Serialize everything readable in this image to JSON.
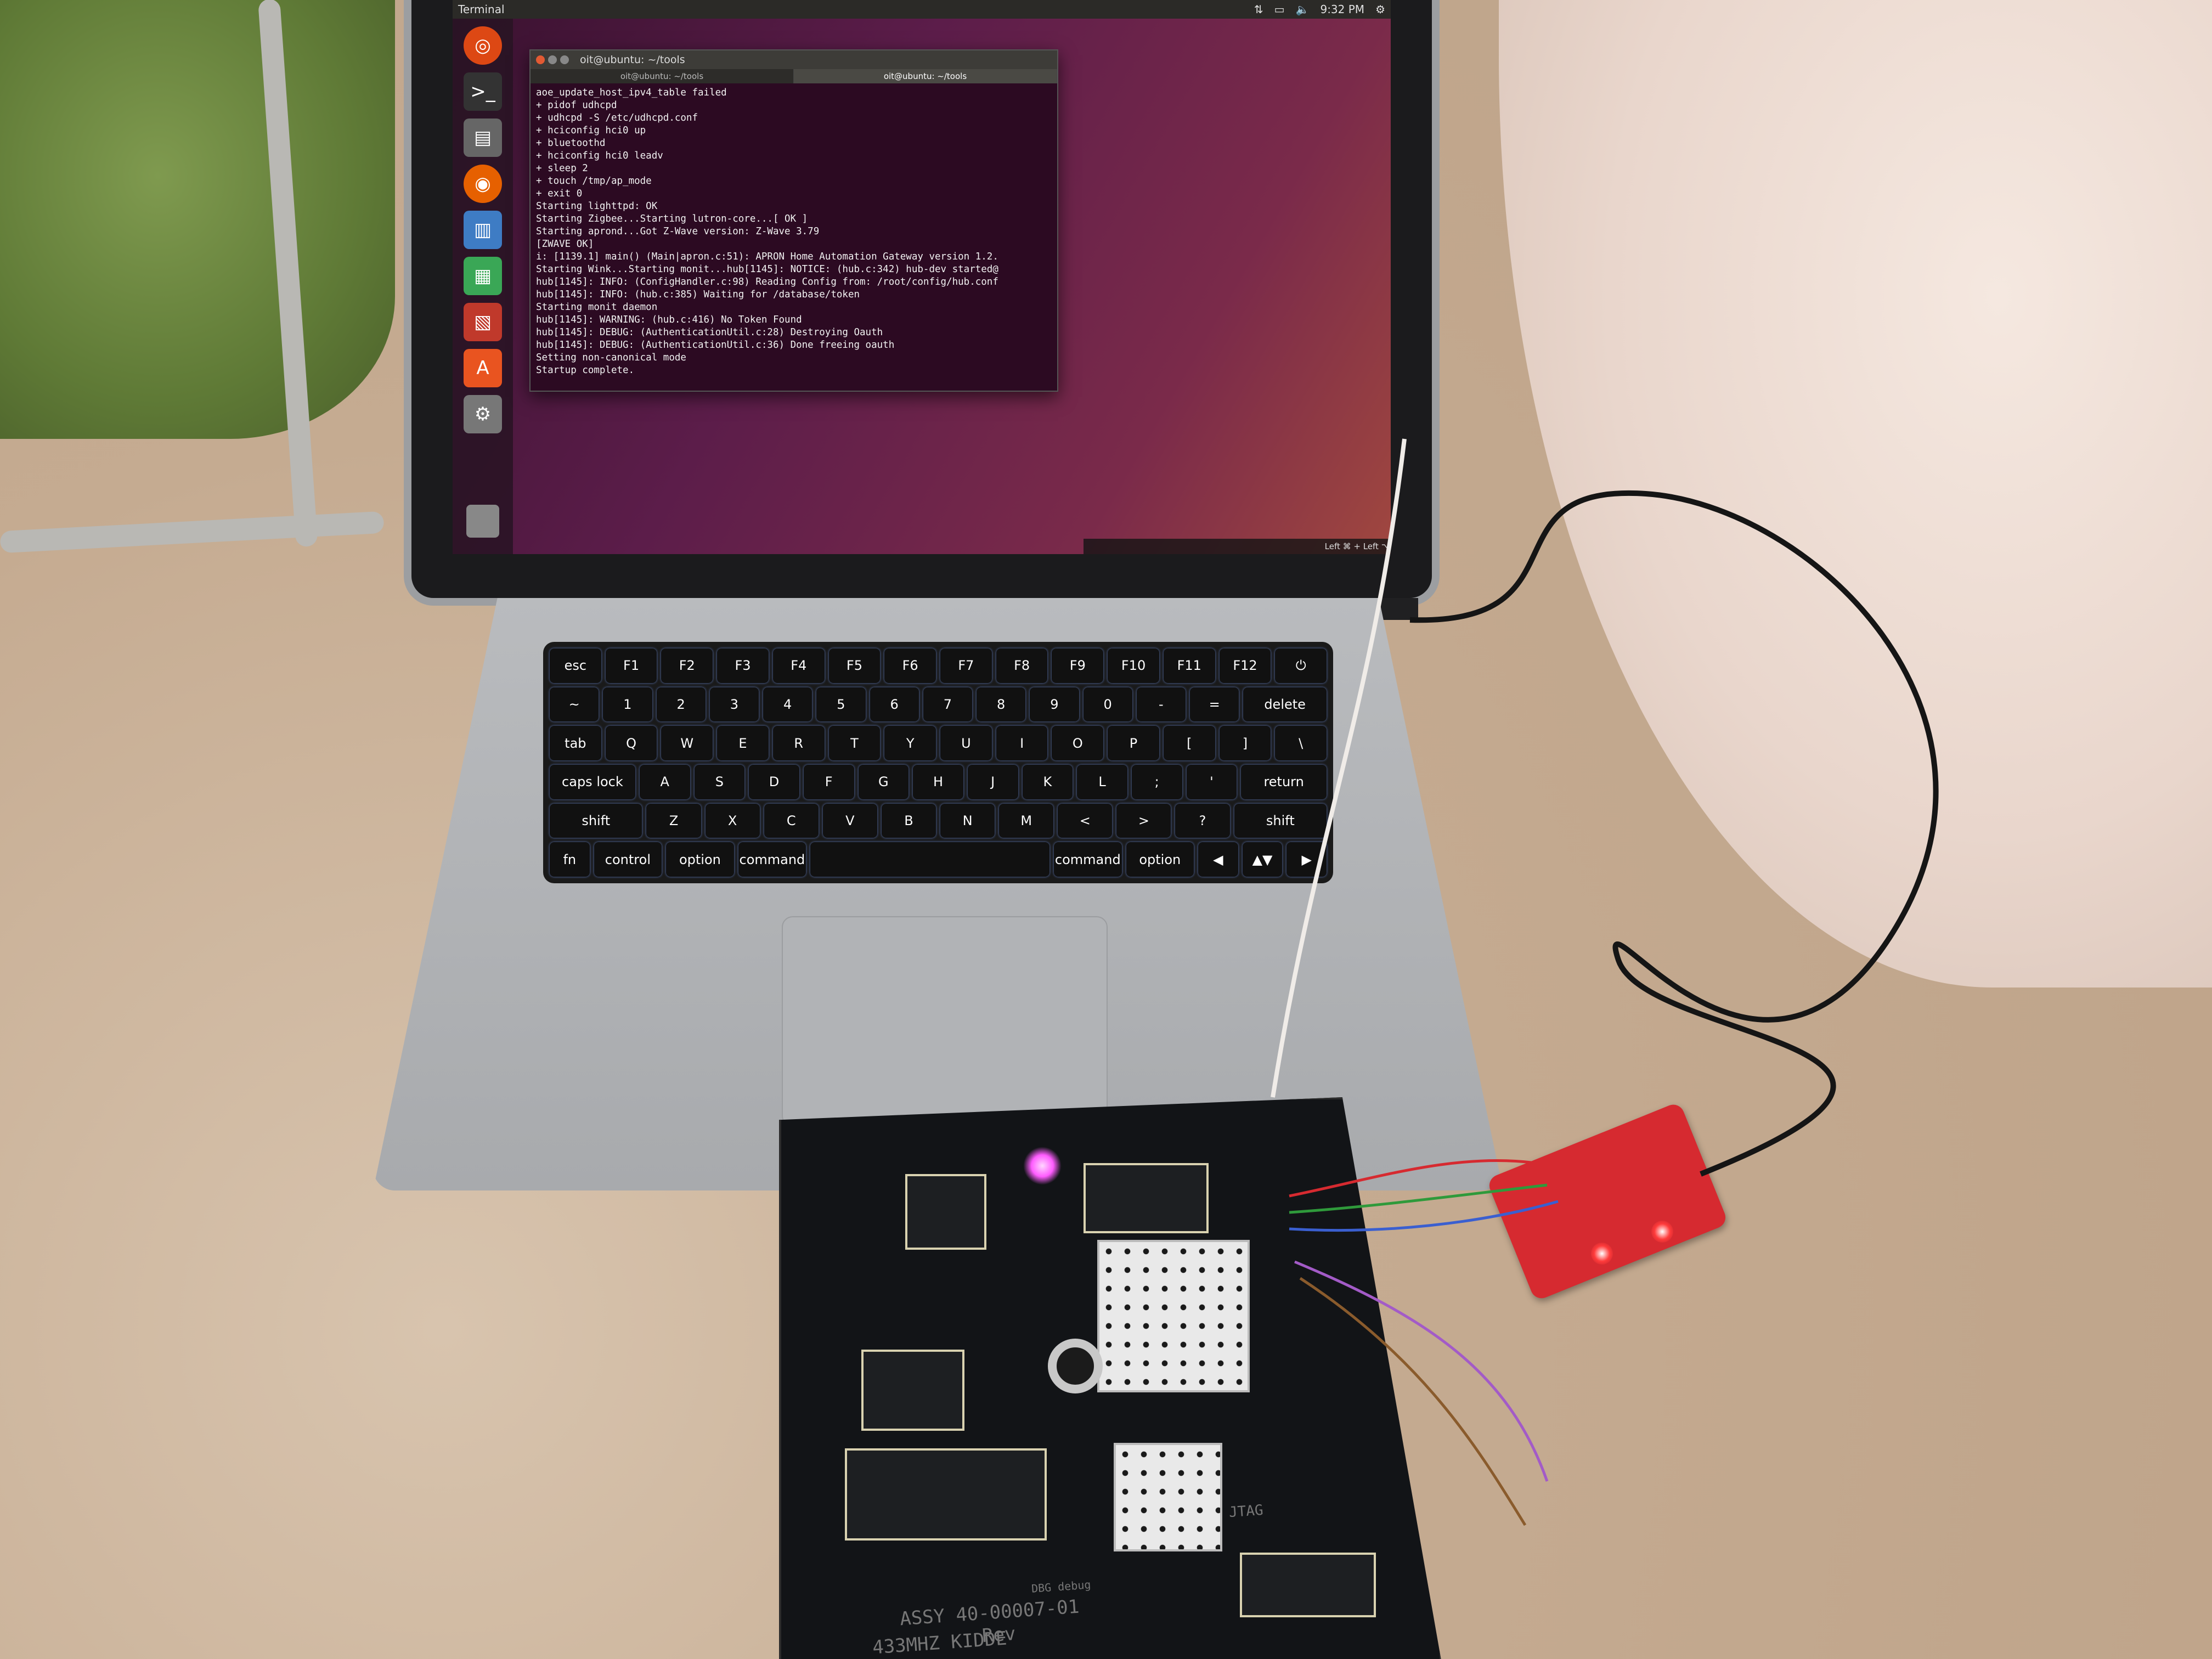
{
  "scene": {
    "description_visible_text": true
  },
  "top_panel": {
    "title": "Terminal",
    "clock": "9:32 PM"
  },
  "terminal": {
    "window_title": "oit@ubuntu: ~/tools",
    "tabs": [
      "oit@ubuntu: ~/tools",
      "oit@ubuntu: ~/tools"
    ],
    "lines": [
      "aoe_update_host_ipv4_table failed",
      "+ pidof udhcpd",
      "+ udhcpd -S /etc/udhcpd.conf",
      "+ hciconfig hci0 up",
      "+ bluetoothd",
      "+ hciconfig hci0 leadv",
      "+ sleep 2",
      "+ touch /tmp/ap_mode",
      "+ exit 0",
      "Starting lighttpd: OK",
      "Starting Zigbee...Starting lutron-core...[ OK ]",
      "Starting aprond...Got Z-Wave version: Z-Wave 3.79",
      "[ZWAVE OK]",
      "i: [1139.1] main() (Main|apron.c:51): APRON Home Automation Gateway version 1.2.",
      "Starting Wink...Starting monit...hub[1145]: NOTICE: (hub.c:342) hub-dev started@",
      "hub[1145]: INFO: (ConfigHandler.c:98) Reading Config from: /root/config/hub.conf",
      "hub[1145]: INFO: (hub.c:385) Waiting for /database/token",
      "Starting monit daemon",
      "hub[1145]: WARNING: (hub.c:416) No Token Found",
      "hub[1145]: DEBUG: (AuthenticationUtil.c:28) Destroying Oauth",
      "hub[1145]: DEBUG: (AuthenticationUtil.c:36) Done freeing oauth",
      "Setting non-canonical mode",
      "Startup complete."
    ]
  },
  "bottom_panel": {
    "status": "Left ⌘ + Left ⌥"
  },
  "keyboard": {
    "rows": [
      [
        "esc",
        "F1",
        "F2",
        "F3",
        "F4",
        "F5",
        "F6",
        "F7",
        "F8",
        "F9",
        "F10",
        "F11",
        "F12",
        "⏻"
      ],
      [
        "~",
        "1",
        "2",
        "3",
        "4",
        "5",
        "6",
        "7",
        "8",
        "9",
        "0",
        "-",
        "=",
        "delete"
      ],
      [
        "tab",
        "Q",
        "W",
        "E",
        "R",
        "T",
        "Y",
        "U",
        "I",
        "O",
        "P",
        "[",
        "]",
        "\\"
      ],
      [
        "caps lock",
        "A",
        "S",
        "D",
        "F",
        "G",
        "H",
        "J",
        "K",
        "L",
        ";",
        "'",
        "return"
      ],
      [
        "shift",
        "Z",
        "X",
        "C",
        "V",
        "B",
        "N",
        "M",
        "<",
        ">",
        "?",
        "shift"
      ],
      [
        "fn",
        "control",
        "option",
        "command",
        "",
        "command",
        "option",
        "◀",
        "▲▼",
        "▶"
      ]
    ]
  },
  "board": {
    "label_assy": "ASSY 40-00007-01",
    "label_rev": "Rev",
    "label_kidde": "433MHZ KIDDE",
    "label_jtag": "JTAG",
    "label_debug": "DBG debug"
  },
  "colors": {
    "wallpaper_start": "#3a1230",
    "wallpaper_end": "#a0473f",
    "board_led": "#ff5cff",
    "adapter": "#d62a30"
  }
}
